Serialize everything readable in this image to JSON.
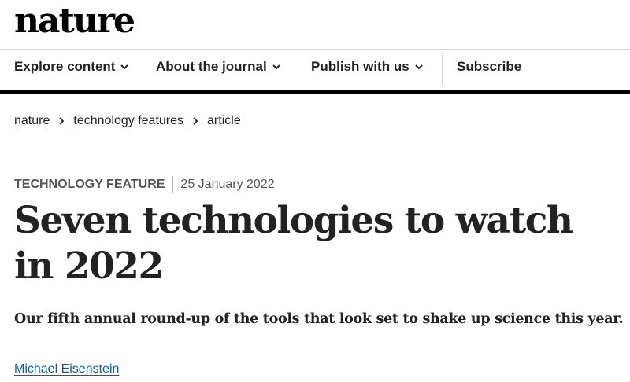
{
  "header": {
    "logo_text": "nature"
  },
  "nav": {
    "items": [
      {
        "label": "Explore content",
        "icon": "chevron-down-icon"
      },
      {
        "label": "About the journal",
        "icon": "chevron-down-icon"
      },
      {
        "label": "Publish with us",
        "icon": "chevron-down-icon"
      }
    ],
    "subscribe_label": "Subscribe"
  },
  "breadcrumb": {
    "items": [
      "nature",
      "technology features",
      "article"
    ],
    "separator_icon": "chevron-right-icon"
  },
  "article": {
    "type": "TECHNOLOGY FEATURE",
    "date": "25 January 2022",
    "title": "Seven technologies to watch in 2022",
    "standfirst": "Our fifth annual round-up of the tools that look set to shake up science this year.",
    "author": "Michael Eisenstein"
  },
  "colors": {
    "link": "#006699",
    "text": "#222222",
    "rule": "#000000"
  }
}
